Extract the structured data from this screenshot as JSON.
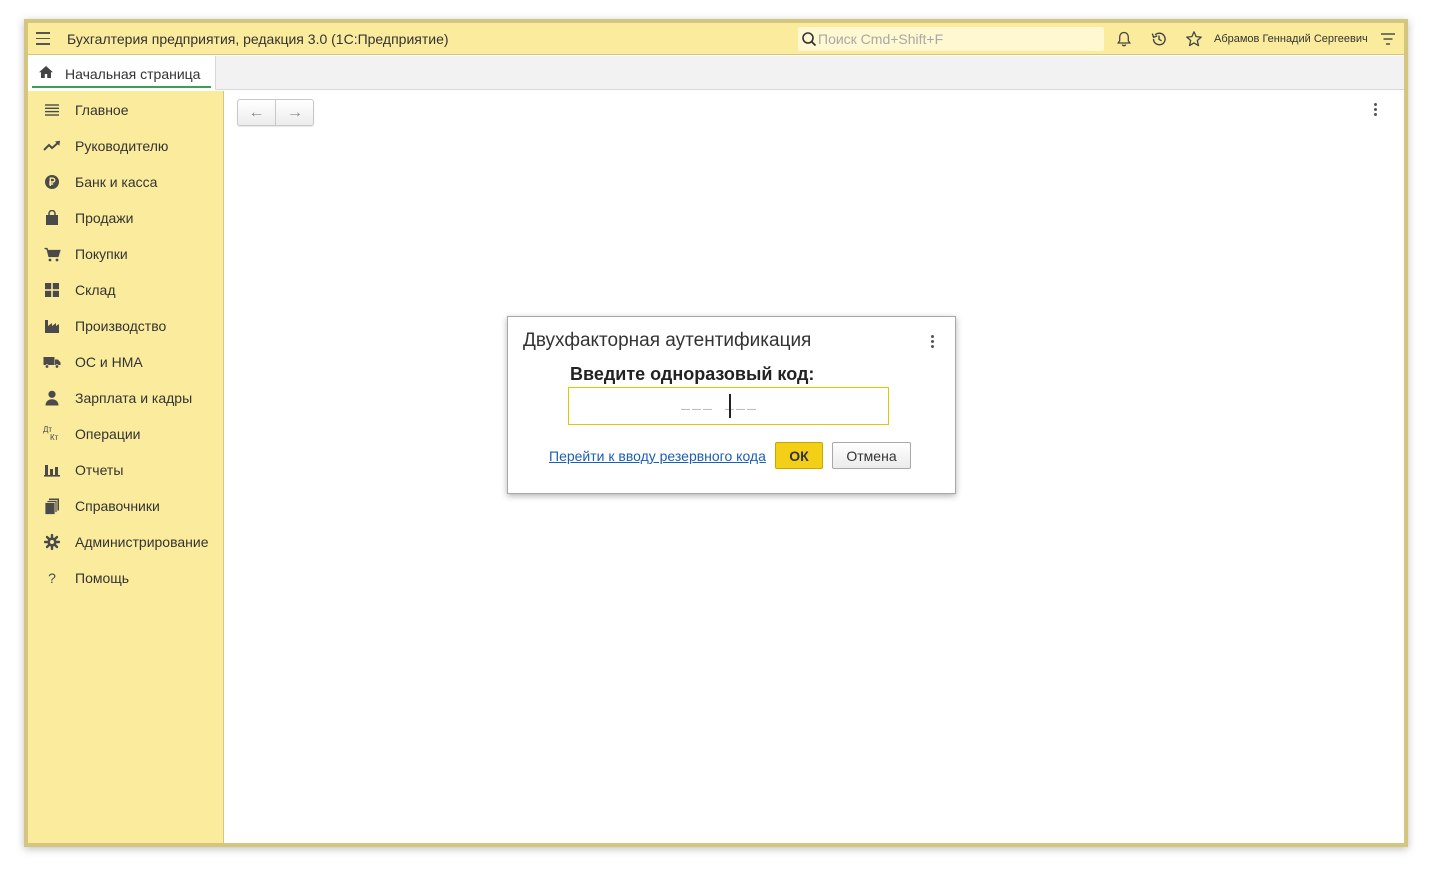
{
  "app": {
    "title": "Бухгалтерия предприятия, редакция 3.0  (1С:Предприятие)",
    "user": "Абрамов Геннадий Сергеевич"
  },
  "search": {
    "placeholder": "Поиск Cmd+Shift+F",
    "value": ""
  },
  "icons": {
    "menu": "hamburger-icon",
    "search": "search-icon",
    "notifications": "bell-icon",
    "history": "history-icon",
    "favorites": "star-icon",
    "main_menu": "menu-lines-icon"
  },
  "tabs": [
    {
      "label": "Начальная страница",
      "icon": "home-icon",
      "active": true
    }
  ],
  "sidebar": {
    "items": [
      {
        "label": "Главное",
        "icon": "list-icon"
      },
      {
        "label": "Руководителю",
        "icon": "trend-icon"
      },
      {
        "label": "Банк и касса",
        "icon": "ruble-icon"
      },
      {
        "label": "Продажи",
        "icon": "bag-icon"
      },
      {
        "label": "Покупки",
        "icon": "cart-icon"
      },
      {
        "label": "Склад",
        "icon": "warehouse-icon"
      },
      {
        "label": "Производство",
        "icon": "factory-icon"
      },
      {
        "label": "ОС и НМА",
        "icon": "truck-icon"
      },
      {
        "label": "Зарплата и кадры",
        "icon": "person-icon"
      },
      {
        "label": "Операции",
        "icon": "dt-kt-icon",
        "icon_text_top": "Дт",
        "icon_text_bottom": "Кт"
      },
      {
        "label": "Отчеты",
        "icon": "bar-chart-icon"
      },
      {
        "label": "Справочники",
        "icon": "books-icon"
      },
      {
        "label": "Администрирование",
        "icon": "gear-icon"
      },
      {
        "label": "Помощь",
        "icon": "question-icon",
        "icon_text": "?"
      }
    ]
  },
  "toolbar": {
    "back": "←",
    "forward": "→"
  },
  "dialog": {
    "title": "Двухфакторная аутентификация",
    "prompt": "Введите одноразовый код:",
    "code_mask": "___ ___",
    "backup_link": "Перейти к вводу резервного кода",
    "ok_label": "ОК",
    "cancel_label": "Отмена"
  },
  "colors": {
    "panel": "#fbec9d",
    "frame": "#d4c67e",
    "ok_button": "#f4cf17",
    "link": "#1a5fb4",
    "tab_underline": "#3b9e5a"
  }
}
